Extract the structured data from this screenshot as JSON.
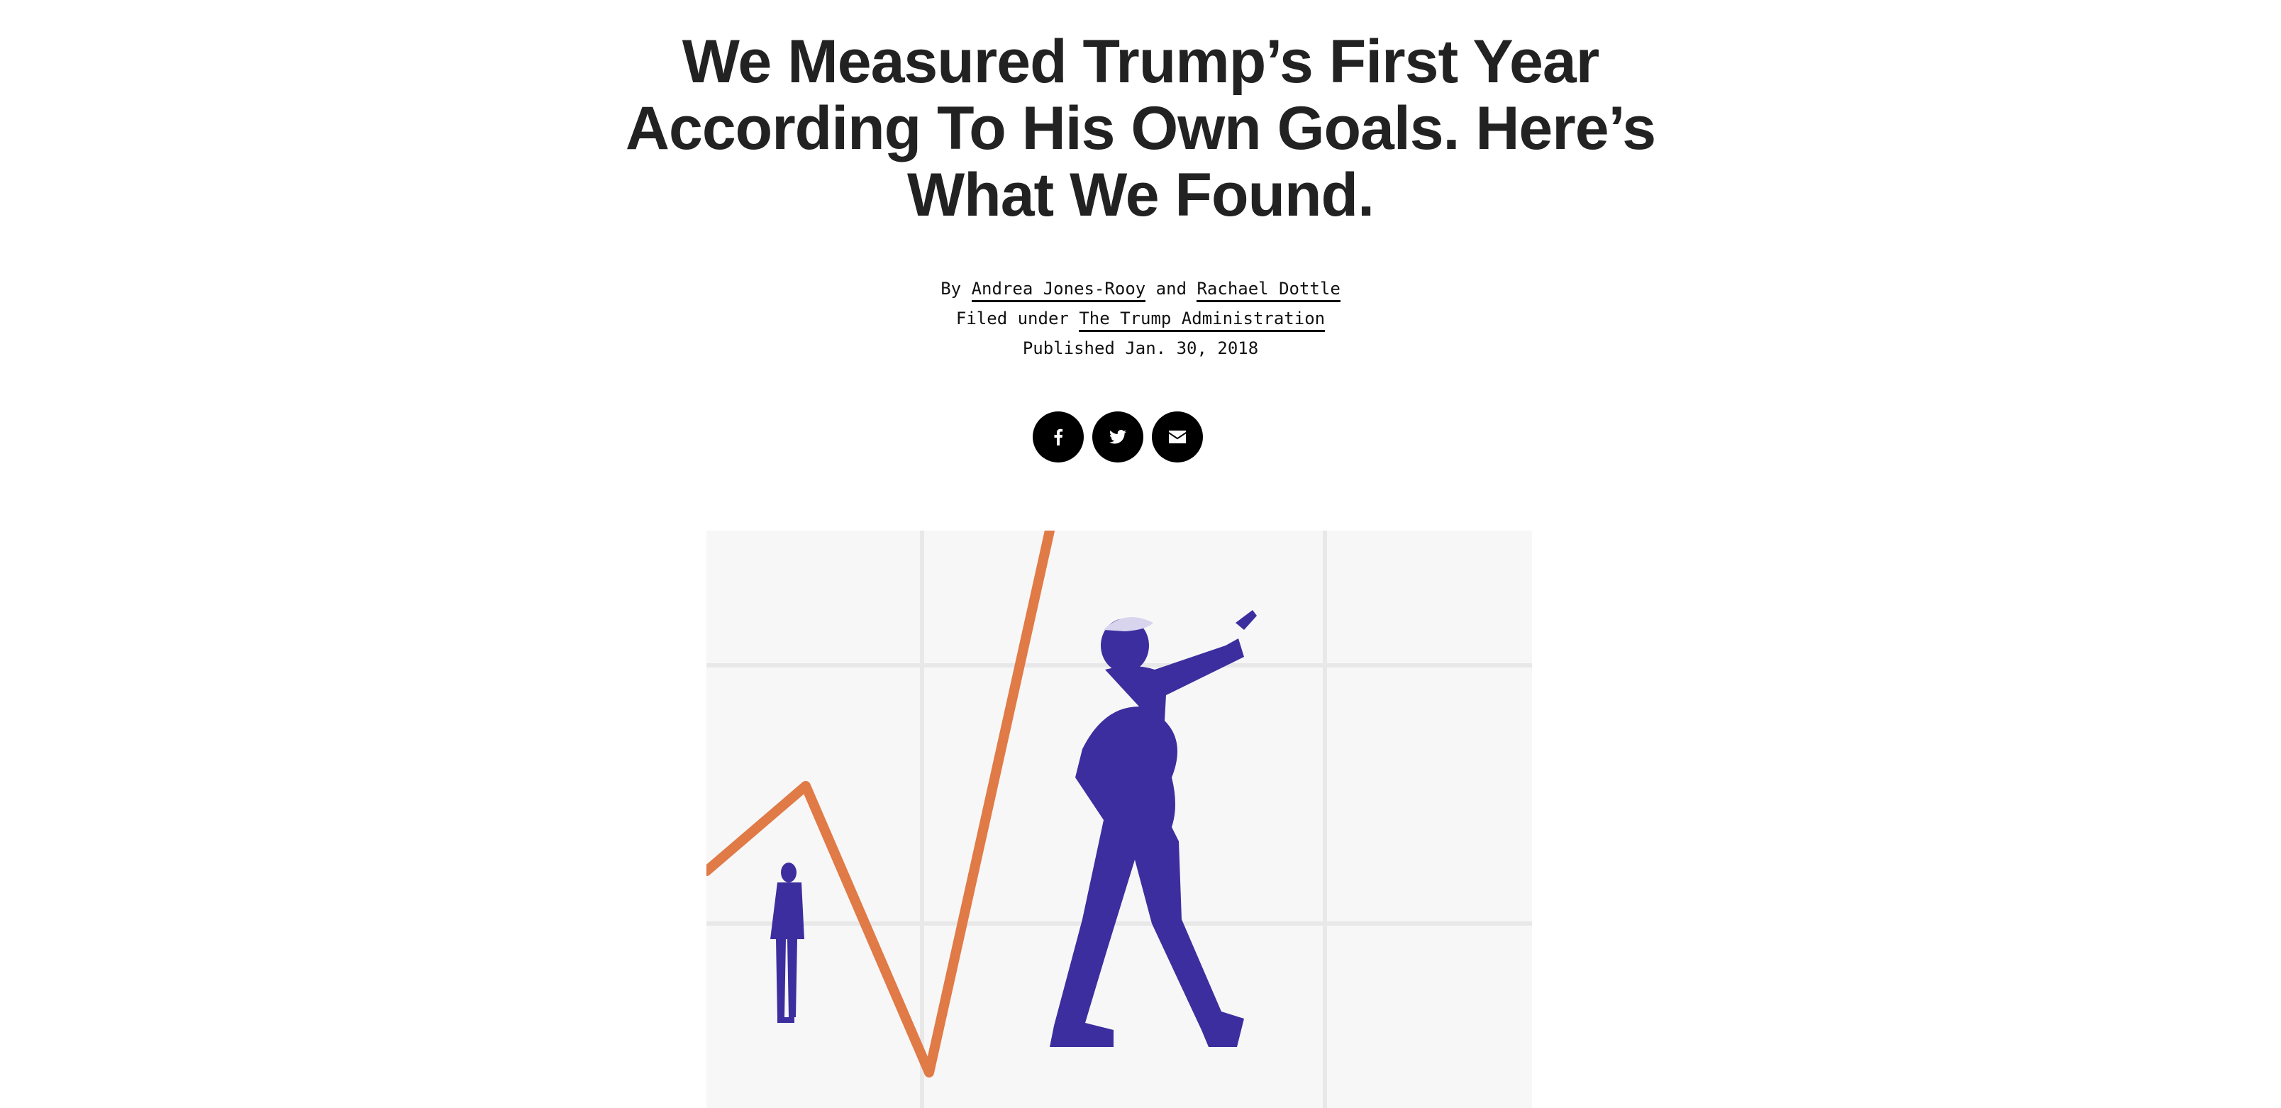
{
  "article": {
    "title": "We Measured Trump’s First Year According To His Own Goals. Here’s What We Found.",
    "byline": {
      "prefix": "By",
      "author_1": "Andrea Jones-Rooy",
      "conjunction": "and",
      "author_2": "Rachael Dottle"
    },
    "filed": {
      "prefix": "Filed under",
      "category": "The Trump Administration"
    },
    "published": "Published Jan. 30, 2018"
  },
  "share": {
    "buttons": [
      {
        "icon": "facebook-icon"
      },
      {
        "icon": "twitter-icon"
      },
      {
        "icon": "email-icon"
      }
    ]
  },
  "hero": {
    "grid_color": "#e8e8e8",
    "line_color": "#e07a47",
    "figure_color": "#3c2e9e",
    "background": "#f7f7f7"
  }
}
